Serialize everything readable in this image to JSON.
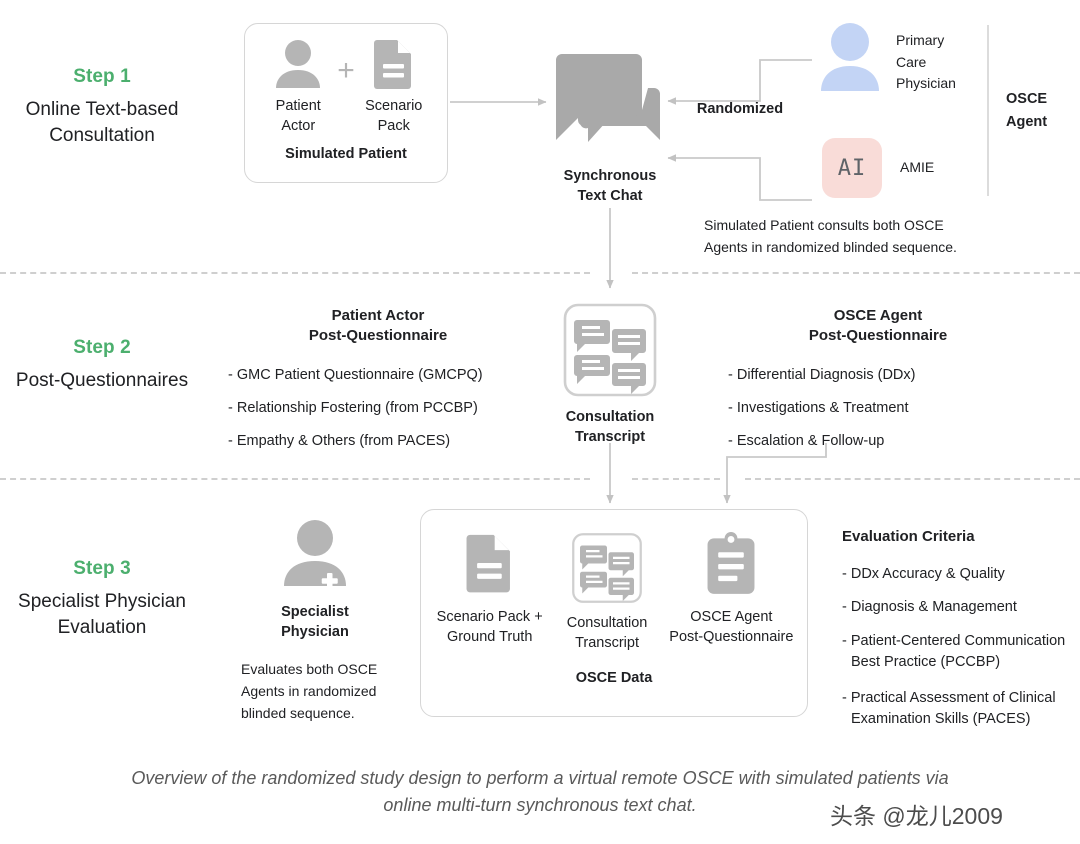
{
  "steps": [
    {
      "number": "Step 1",
      "title": "Online Text-based\nConsultation"
    },
    {
      "number": "Step 2",
      "title": "Post-Questionnaires"
    },
    {
      "number": "Step 3",
      "title": "Specialist Physician\nEvaluation"
    }
  ],
  "step1": {
    "simulated_patient": {
      "box_label": "Simulated Patient",
      "items": [
        {
          "icon": "person-icon",
          "label_line1": "Patient",
          "label_line2": "Actor"
        },
        {
          "icon": "document-icon",
          "label_line1": "Scenario",
          "label_line2": "Pack"
        }
      ],
      "plus": "+"
    },
    "chat": {
      "icon": "chat-bubbles-icon",
      "label_line1": "Synchronous",
      "label_line2": "Text Chat"
    },
    "randomized_label": "Randomized",
    "agents": [
      {
        "icon": "person-icon-blue",
        "label": "Primary\nCare\nPhysician"
      },
      {
        "icon": "ai-badge-icon",
        "badge_text": "AI",
        "label": "AMIE"
      }
    ],
    "osce_agent_label": "OSCE\nAgent",
    "note": "Simulated Patient consults both OSCE\nAgents in randomized blinded sequence."
  },
  "step2": {
    "patient_actor": {
      "heading": "Patient Actor\nPost-Questionnaire",
      "items": [
        "- GMC Patient Questionnaire (GMCPQ)",
        "- Relationship Fostering (from PCCBP)",
        "- Empathy & Others (from PACES)"
      ]
    },
    "transcript": {
      "icon": "transcript-icon",
      "label_line1": "Consultation",
      "label_line2": "Transcript"
    },
    "osce_agent": {
      "heading": "OSCE Agent\nPost-Questionnaire",
      "items": [
        "- Differential Diagnosis (DDx)",
        "- Investigations & Treatment",
        "- Escalation & Follow-up"
      ]
    }
  },
  "step3": {
    "specialist": {
      "icon": "physician-icon",
      "label_line1": "Specialist",
      "label_line2": "Physician",
      "note": "Evaluates both OSCE\nAgents in randomized\nblinded sequence."
    },
    "osce_data": {
      "box_label": "OSCE Data",
      "items": [
        {
          "icon": "document-icon",
          "label_line1": "Scenario Pack +",
          "label_line2": "Ground Truth"
        },
        {
          "icon": "transcript-icon",
          "label_line1": "Consultation",
          "label_line2": "Transcript"
        },
        {
          "icon": "clipboard-icon",
          "label_line1": "OSCE Agent",
          "label_line2": "Post-Questionnaire"
        }
      ]
    },
    "criteria": {
      "heading": "Evaluation Criteria",
      "items": [
        "- DDx Accuracy & Quality",
        "- Diagnosis & Management",
        "- Patient-Centered Communication\n  Best Practice (PCCBP)",
        "- Practical Assessment of Clinical\n  Examination Skills (PACES)"
      ]
    }
  },
  "caption": "Overview of the randomized study design to perform a virtual remote OSCE with simulated patients via online multi-turn synchronous text chat.",
  "watermark": "头条 @龙儿2009",
  "colors": {
    "accent_green": "#4caf6e",
    "icon_gray": "#b5b5b5",
    "icon_blue": "#c3d4f5",
    "ai_badge_bg": "#f9dcd8",
    "border_gray": "#d6d6d6",
    "dash_gray": "#cfcfcf"
  }
}
